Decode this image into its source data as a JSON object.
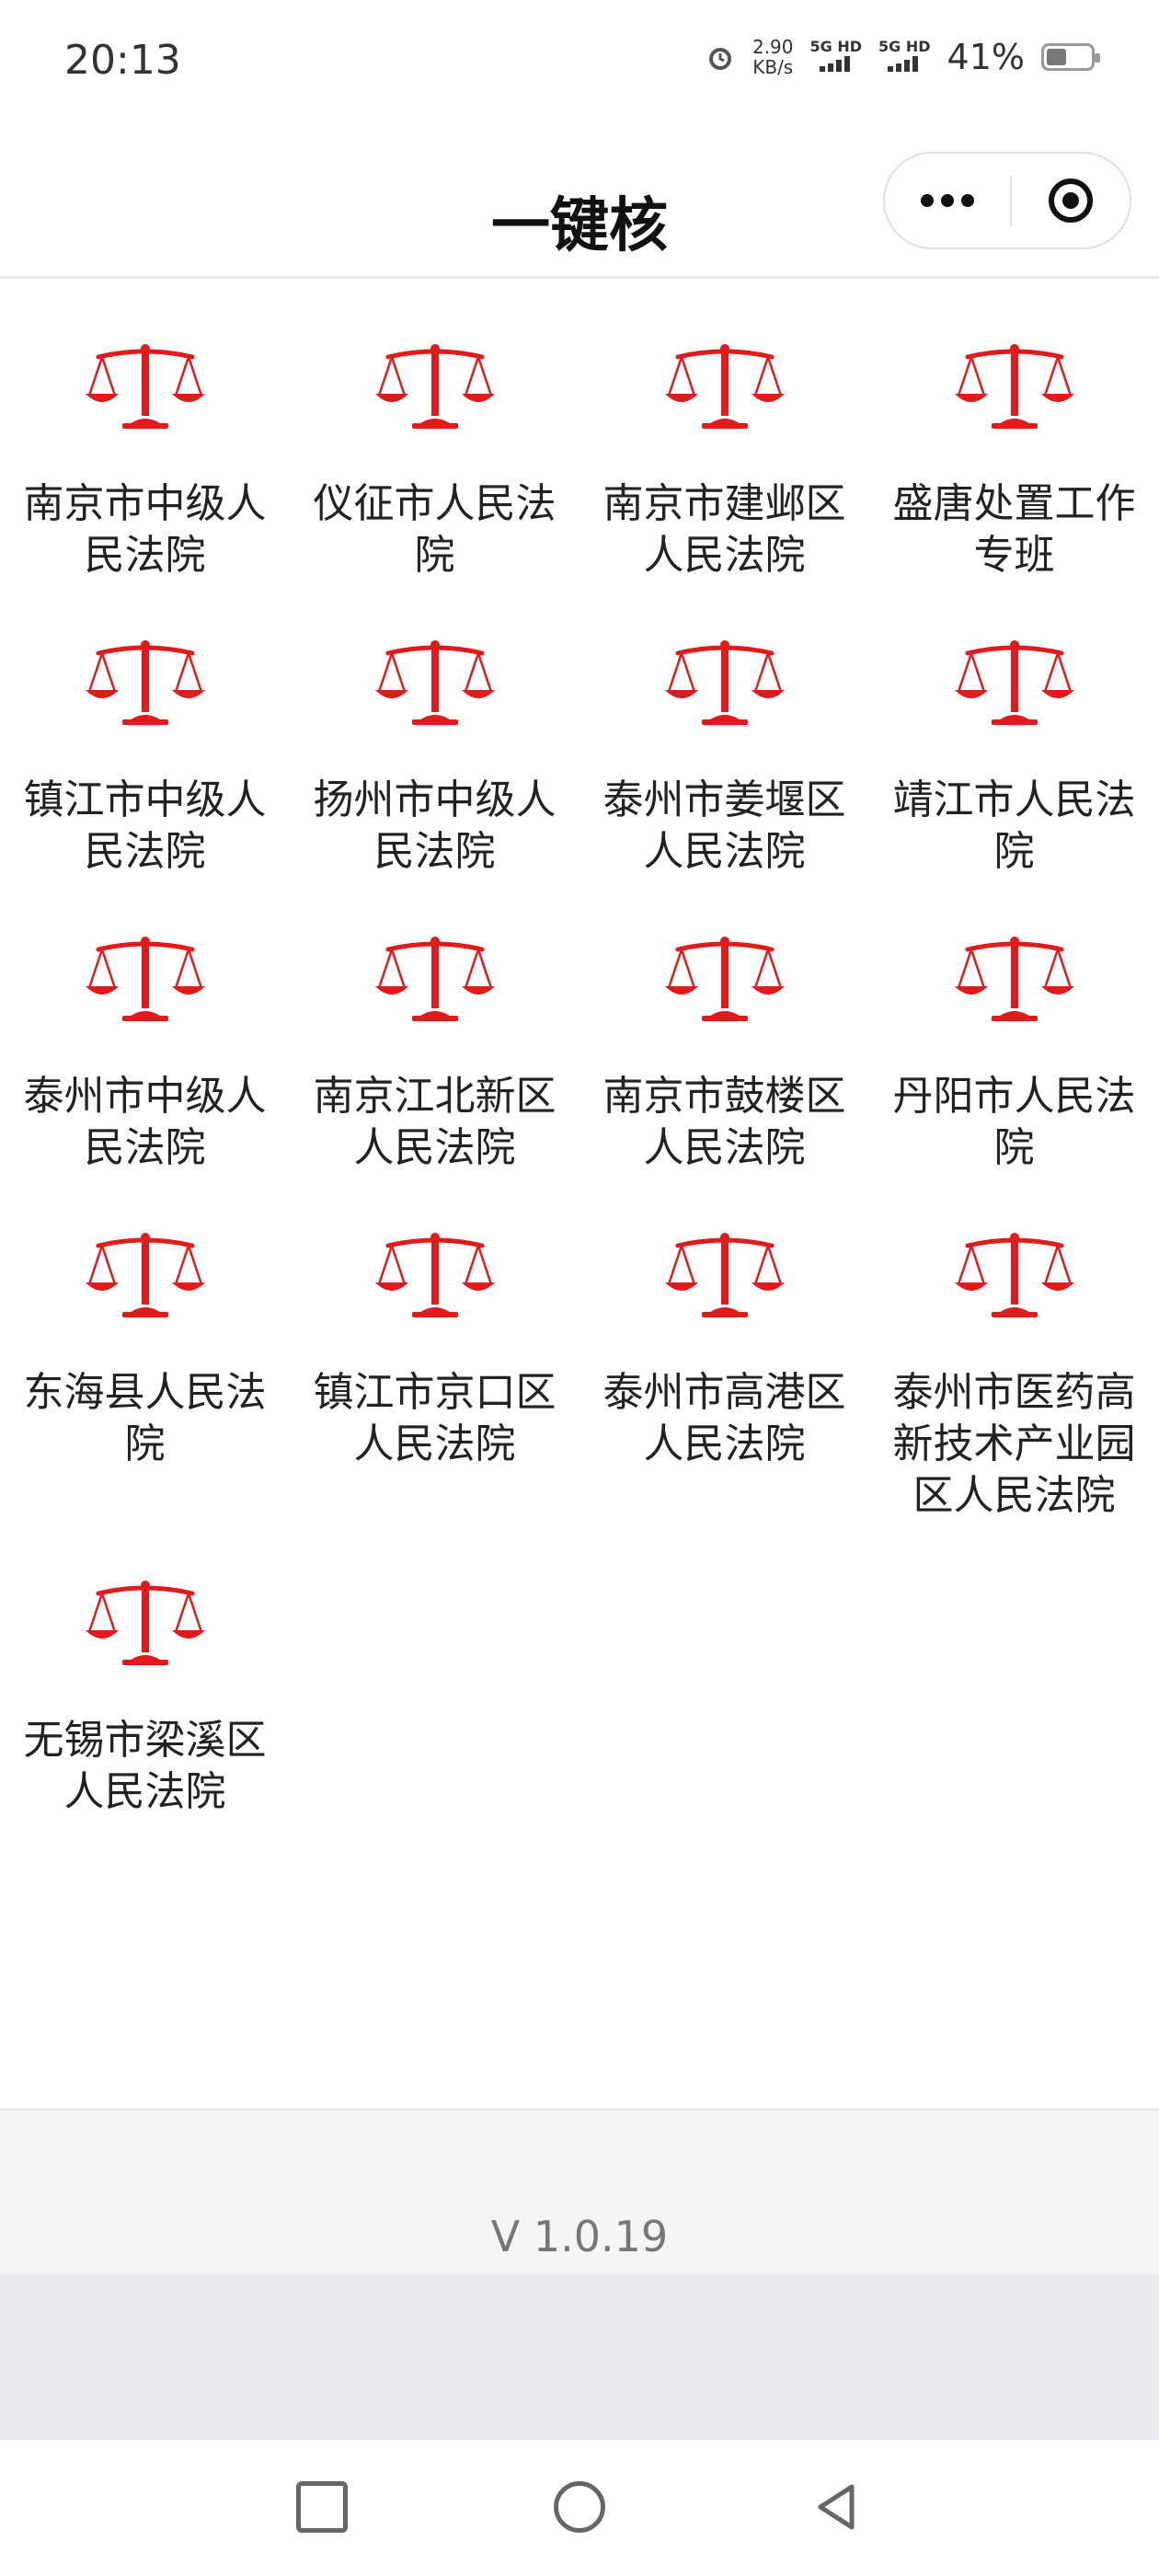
{
  "status_bar": {
    "time": "20:13",
    "speed_value": "2.90",
    "speed_unit": "KB/s",
    "net1": "5G HD",
    "net2": "5G HD",
    "battery": "41%",
    "alarm_icon": "alarm-clock-icon"
  },
  "nav": {
    "title": "一键核"
  },
  "courts": [
    {
      "name": "南京市中级人民法院"
    },
    {
      "name": "仪征市人民法院"
    },
    {
      "name": "南京市建邺区人民法院"
    },
    {
      "name": "盛唐处置工作专班"
    },
    {
      "name": "镇江市中级人民法院"
    },
    {
      "name": "扬州市中级人民法院"
    },
    {
      "name": "泰州市姜堰区人民法院"
    },
    {
      "name": "靖江市人民法院"
    },
    {
      "name": "泰州市中级人民法院"
    },
    {
      "name": "南京江北新区人民法院"
    },
    {
      "name": "南京市鼓楼区人民法院"
    },
    {
      "name": "丹阳市人民法院"
    },
    {
      "name": "东海县人民法院"
    },
    {
      "name": "镇江市京口区人民法院"
    },
    {
      "name": "泰州市高港区人民法院"
    },
    {
      "name": "泰州市医药高新技术产业园区人民法院"
    },
    {
      "name": "无锡市梁溪区人民法院"
    }
  ],
  "footer": {
    "version": "V 1.0.19"
  },
  "colors": {
    "icon_red": "#e01b1b"
  }
}
